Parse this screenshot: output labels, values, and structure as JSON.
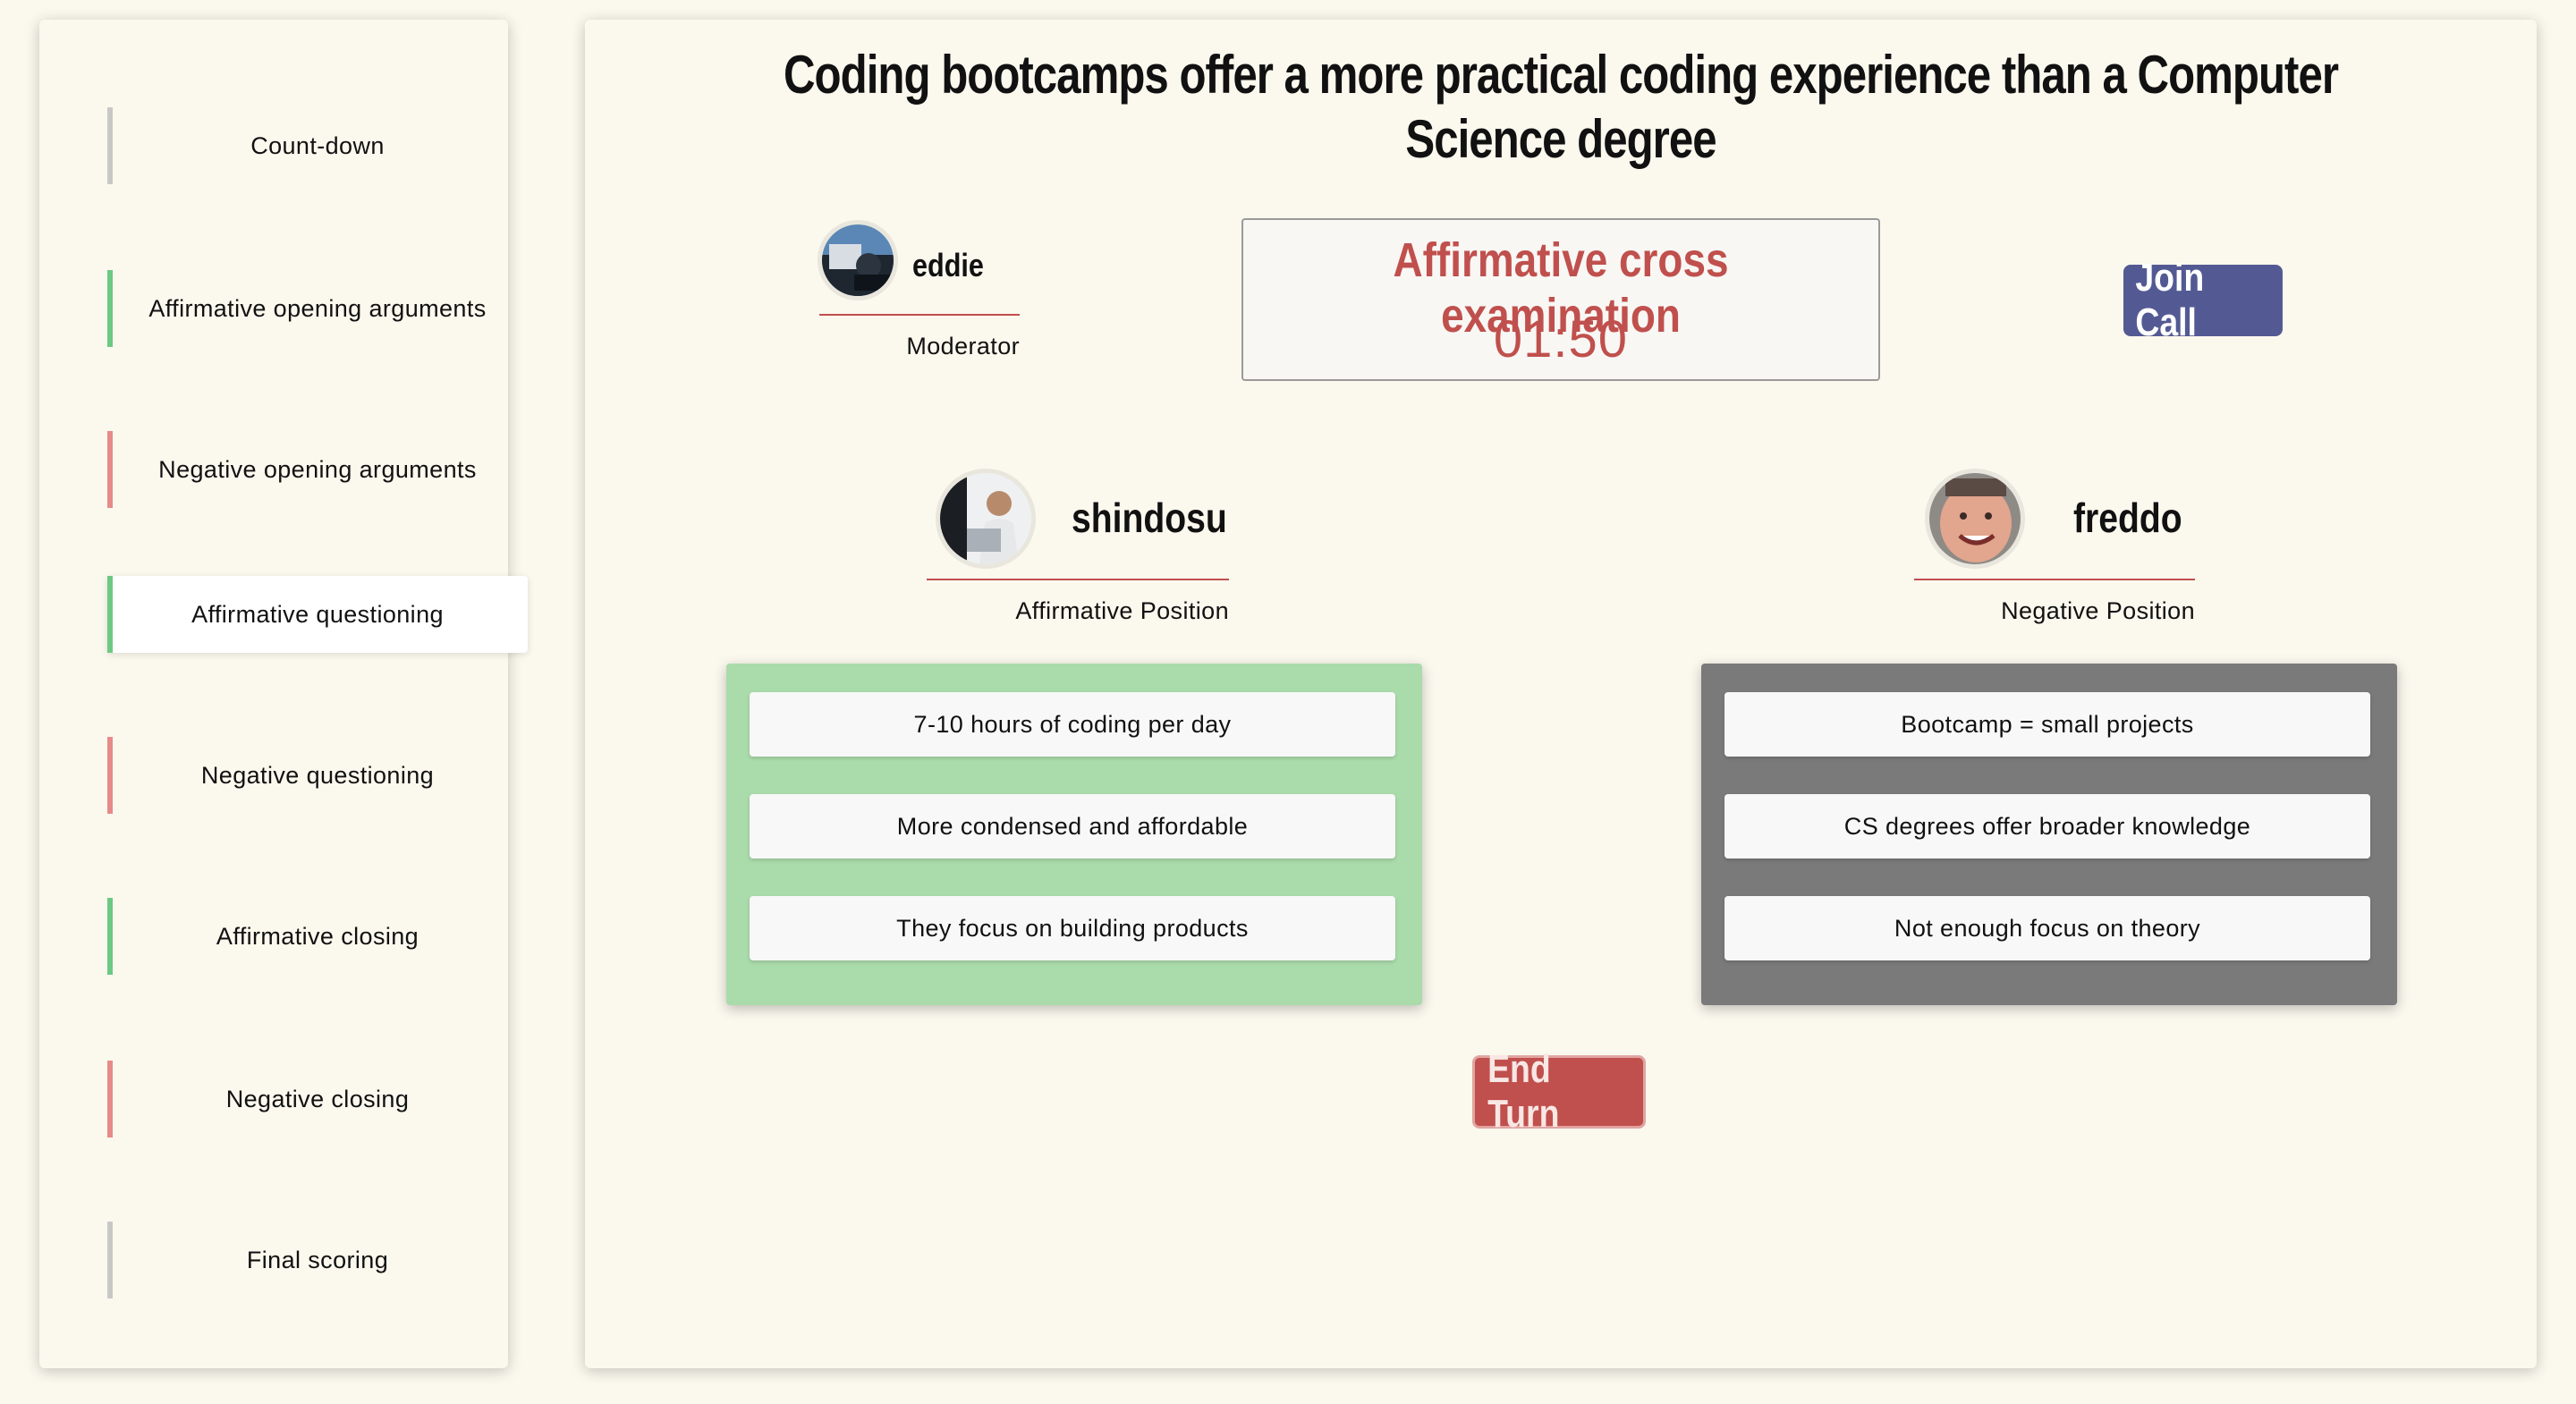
{
  "sidebar": {
    "stages": [
      {
        "label": "Count-down",
        "bar_color": "#c8c8c8",
        "active": false
      },
      {
        "label": "Affirmative opening arguments",
        "bar_color": "#6cc983",
        "active": false
      },
      {
        "label": "Negative opening arguments",
        "bar_color": "#e88a8a",
        "active": false
      },
      {
        "label": "Affirmative questioning",
        "bar_color": "#6cc983",
        "active": true
      },
      {
        "label": "Negative questioning",
        "bar_color": "#e88a8a",
        "active": false
      },
      {
        "label": "Affirmative closing",
        "bar_color": "#6cc983",
        "active": false
      },
      {
        "label": "Negative closing",
        "bar_color": "#e88a8a",
        "active": false
      },
      {
        "label": "Final scoring",
        "bar_color": "#c8c8c8",
        "active": false
      }
    ]
  },
  "debate": {
    "title": "Coding bootcamps offer a more practical coding experience than a Computer Science degree"
  },
  "moderator": {
    "name": "eddie",
    "role": "Moderator"
  },
  "timer": {
    "phase": "Affirmative cross examination",
    "time": "01:50"
  },
  "join_call_label": "Join Call",
  "affirmative": {
    "name": "shindosu",
    "role": "Affirmative Position",
    "panel_color": "#aadbab",
    "arguments": [
      "7-10 hours of coding per day",
      "More condensed and affordable",
      "They focus on building products"
    ]
  },
  "negative": {
    "name": "freddo",
    "role": "Negative Position",
    "panel_color": "#7a7a7a",
    "arguments": [
      "Bootcamp = small projects",
      "CS degrees offer broader knowledge",
      "Not enough focus on theory"
    ]
  },
  "end_turn_label": "End Turn",
  "colors": {
    "accent_red": "#c0504d",
    "join_blue": "#535a93",
    "background": "#fbf8ee"
  }
}
